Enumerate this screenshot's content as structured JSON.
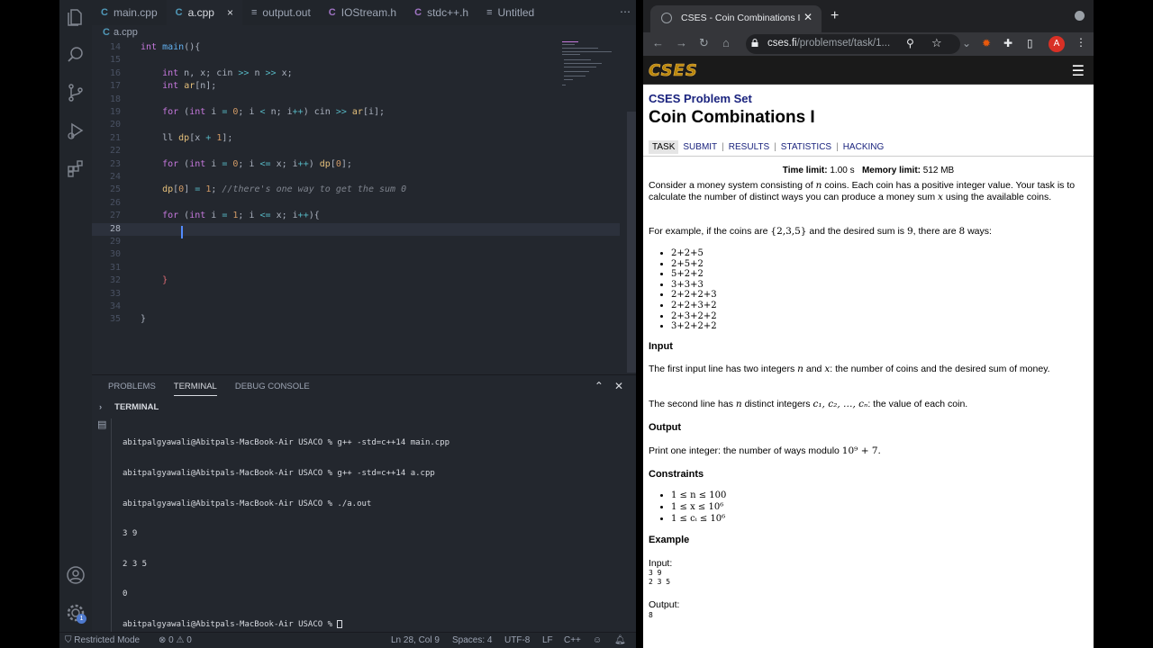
{
  "vscode": {
    "tabs": [
      {
        "icon": "C",
        "label": "main.cpp"
      },
      {
        "icon": "C",
        "label": "a.cpp",
        "close": "×"
      },
      {
        "icon": "≡",
        "label": "output.out"
      },
      {
        "icon": "C",
        "label": "IOStream.h"
      },
      {
        "icon": "C",
        "label": "stdc++.h"
      },
      {
        "icon": "≡",
        "label": "Untitled"
      }
    ],
    "more_actions": "⋯",
    "breadcrumb": {
      "icon": "C",
      "file": "a.cpp"
    },
    "line_numbers": [
      "14",
      "15",
      "16",
      "17",
      "18",
      "19",
      "20",
      "21",
      "22",
      "23",
      "24",
      "25",
      "26",
      "27",
      "28",
      "29",
      "30",
      "31",
      "32",
      "33",
      "34",
      "35"
    ],
    "panel": {
      "tabs": [
        "PROBLEMS",
        "TERMINAL",
        "DEBUG CONSOLE"
      ],
      "header": "TERMINAL",
      "terminal_lines": [
        "abitpalgyawali@Abitpals-MacBook-Air USACO % g++ -std=c++14 main.cpp",
        "abitpalgyawali@Abitpals-MacBook-Air USACO % g++ -std=c++14 a.cpp",
        "abitpalgyawali@Abitpals-MacBook-Air USACO % ./a.out",
        "3 9",
        "2 3 5",
        "0",
        "abitpalgyawali@Abitpals-MacBook-Air USACO % "
      ]
    },
    "status": {
      "restricted": "Restricted Mode",
      "errors": "0",
      "warnings": "0",
      "position": "Ln 28, Col 9",
      "spaces": "Spaces: 4",
      "encoding": "UTF-8",
      "eol": "LF",
      "language": "C++",
      "accounts_badge": "1"
    }
  },
  "browser": {
    "tab_title": "CSES - Coin Combinations I",
    "url_host": "cses.fi",
    "url_path": "/problemset/task/1...",
    "profile_initial": "A",
    "site_logo": "CSES",
    "problem_set": "CSES Problem Set",
    "task_title": "Coin Combinations I",
    "nav": [
      "TASK",
      "SUBMIT",
      "RESULTS",
      "STATISTICS",
      "HACKING"
    ],
    "time_limit_label": "Time limit:",
    "time_limit": "1.00 s",
    "memory_limit_label": "Memory limit:",
    "memory_limit": "512 MB",
    "statement": {
      "p1_a": "Consider a money system consisting of",
      "p1_b": "coins. Each coin has a positive integer value. Your task is to calculate the number of distinct ways you can produce a money sum",
      "p1_c": "using the available coins.",
      "p2_a": "For example, if the coins are",
      "p2_set": "{2,3,5}",
      "p2_b": "and the desired sum is",
      "p2_n": "9",
      "p2_c": ", there are",
      "p2_k": "8",
      "p2_d": "ways:",
      "ways": [
        "2+2+5",
        "2+5+2",
        "5+2+2",
        "3+3+3",
        "2+2+2+3",
        "2+2+3+2",
        "2+3+2+2",
        "3+2+2+2"
      ],
      "input_h": "Input",
      "input_p1_a": "The first input line has two integers",
      "input_p1_b": "and",
      "input_p1_c": ": the number of coins and the desired sum of money.",
      "input_p2_a": "The second line has",
      "input_p2_b": "distinct integers",
      "input_p2_c": ": the value of each coin.",
      "output_h": "Output",
      "output_p": "Print one integer: the number of ways modulo",
      "output_mod": "10⁹ + 7.",
      "constraints_h": "Constraints",
      "constraints": [
        "1 ≤ n ≤ 100",
        "1 ≤ x ≤ 10⁶",
        "1 ≤ cᵢ ≤ 10⁶"
      ],
      "example_h": "Example",
      "input_label": "Input:",
      "example_input": "3 9\n2 3 5",
      "output_label": "Output:",
      "example_output": "8"
    },
    "math": {
      "n": "n",
      "x": "x",
      "c_list": "c₁, c₂, …, cₙ"
    }
  }
}
